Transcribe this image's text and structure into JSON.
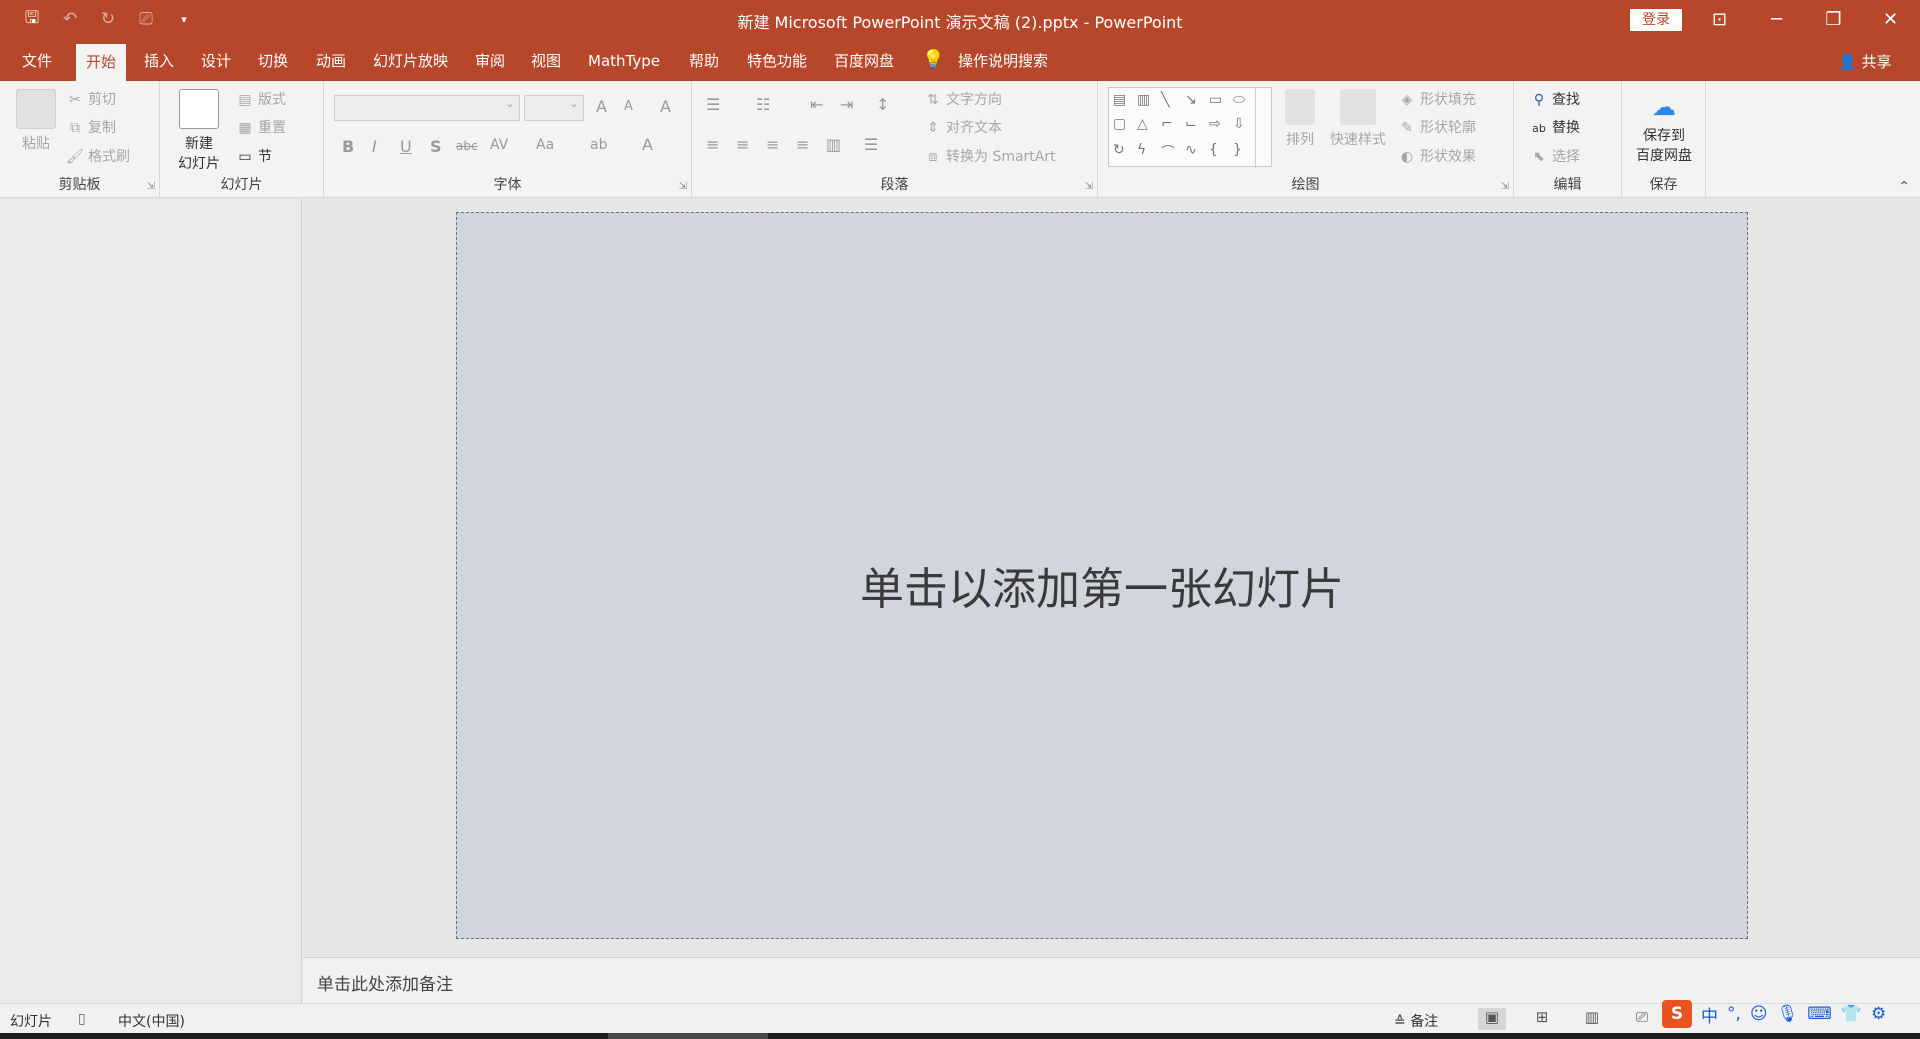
{
  "titlebar": {
    "title": "新建 Microsoft PowerPoint 演示文稿 (2).pptx  -  PowerPoint",
    "login": "登录",
    "qat": {
      "save": "🖫",
      "undo": "↶",
      "redo": "↻",
      "present": "⎚",
      "customize": "▾"
    },
    "window": {
      "ribbon_display": "⊡",
      "minimize": "─",
      "restore": "❐",
      "close": "✕"
    }
  },
  "tabs": {
    "items": [
      "文件",
      "开始",
      "插入",
      "设计",
      "切换",
      "动画",
      "幻灯片放映",
      "审阅",
      "视图",
      "MathType",
      "帮助",
      "特色功能",
      "百度网盘"
    ],
    "tell_me": "操作说明搜索",
    "share": "共享"
  },
  "ribbon": {
    "clipboard": {
      "label": "剪贴板",
      "paste": "粘贴",
      "cut": "剪切",
      "copy": "复制",
      "format_painter": "格式刷"
    },
    "slides": {
      "label": "幻灯片",
      "new_slide_line1": "新建",
      "new_slide_line2": "幻灯片",
      "layout": "版式",
      "reset": "重置",
      "section": "节"
    },
    "font": {
      "label": "字体",
      "bold": "B",
      "italic": "I",
      "underline": "U",
      "shadow": "S",
      "strike": "abc",
      "spacing": "AV",
      "case": "Aa",
      "grow": "A",
      "shrink": "A",
      "clear": "A",
      "highlight": "ab",
      "color": "A"
    },
    "paragraph": {
      "label": "段落",
      "text_direction": "文字方向",
      "align_text": "对齐文本",
      "smartart": "转换为 SmartArt"
    },
    "drawing": {
      "label": "绘图",
      "arrange": "排列",
      "quick_styles": "快速样式",
      "shape_fill": "形状填充",
      "shape_outline": "形状轮廓",
      "shape_effects": "形状效果"
    },
    "editing": {
      "label": "编辑",
      "find": "查找",
      "replace": "替换",
      "select": "选择"
    },
    "save": {
      "label": "保存",
      "save_to_line1": "保存到",
      "save_to_line2": "百度网盘"
    }
  },
  "slide": {
    "placeholder": "单击以添加第一张幻灯片"
  },
  "notes": {
    "placeholder": "单击此处添加备注"
  },
  "status": {
    "slide": "幻灯片",
    "language": "中文(中国)",
    "notes": "备注"
  },
  "ime": {
    "sogou": "S",
    "mode": "中",
    "punct": "°,",
    "emoji": "☺",
    "mic": "🎙",
    "keyboard": "⌨",
    "skin": "👕",
    "tools": "⚙"
  },
  "colors": {
    "accent": "#b7472a",
    "slide_bg": "#d1d5de"
  }
}
